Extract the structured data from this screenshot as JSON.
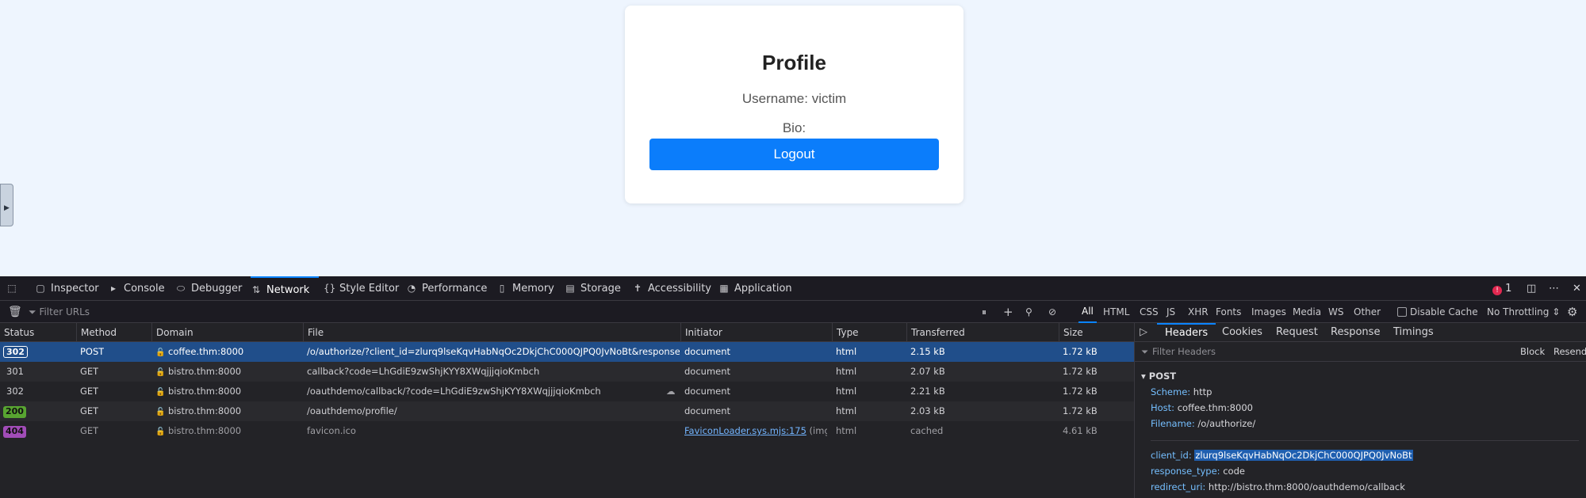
{
  "profile": {
    "title": "Profile",
    "username": "Username: victim",
    "bio": "Bio:",
    "logout": "Logout"
  },
  "devtools": {
    "tabs": [
      "Inspector",
      "Console",
      "Debugger",
      "Network",
      "Style Editor",
      "Performance",
      "Memory",
      "Storage",
      "Accessibility",
      "Application"
    ],
    "active_tab": "Network",
    "error_count": "1",
    "filter_placeholder": "Filter URLs",
    "type_filters": [
      "All",
      "HTML",
      "CSS",
      "JS",
      "XHR",
      "Fonts",
      "Images",
      "Media",
      "WS",
      "Other"
    ],
    "disable_cache": "Disable Cache",
    "throttling": "No Throttling ⇕",
    "columns": [
      "Status",
      "Method",
      "Domain",
      "File",
      "Initiator",
      "Type",
      "Transferred",
      "Size"
    ],
    "rows": [
      {
        "status": "302",
        "method": "POST",
        "domain": "coffee.thm:8000",
        "file": "/o/authorize/?client_id=zlurq9lseKqvHabNqOc2DkjChC000QJPQ0JvNoBt&response_type=",
        "initiator": "document",
        "initiator_suffix": "",
        "type": "html",
        "transferred": "2.15 kB",
        "size": "1.72 kB"
      },
      {
        "status": "301",
        "method": "GET",
        "domain": "bistro.thm:8000",
        "file": "callback?code=LhGdiE9zwShjKYY8XWqjjjqioKmbch",
        "initiator": "document",
        "initiator_suffix": "",
        "type": "html",
        "transferred": "2.07 kB",
        "size": "1.72 kB"
      },
      {
        "status": "302",
        "method": "GET",
        "domain": "bistro.thm:8000",
        "file": "/oauthdemo/callback/?code=LhGdiE9zwShjKYY8XWqjjjqioKmbch",
        "initiator": "document",
        "initiator_suffix": "",
        "type": "html",
        "transferred": "2.21 kB",
        "size": "1.72 kB"
      },
      {
        "status": "200",
        "method": "GET",
        "domain": "bistro.thm:8000",
        "file": "/oauthdemo/profile/",
        "initiator": "document",
        "initiator_suffix": "",
        "type": "html",
        "transferred": "2.03 kB",
        "size": "1.72 kB"
      },
      {
        "status": "404",
        "method": "GET",
        "domain": "bistro.thm:8000",
        "file": "favicon.ico",
        "initiator": "FaviconLoader.sys.mjs:175",
        "initiator_suffix": " (img)",
        "type": "html",
        "transferred": "cached",
        "size": "4.61 kB"
      }
    ],
    "side_tabs": [
      "Headers",
      "Cookies",
      "Request",
      "Response",
      "Timings"
    ],
    "side_filter_placeholder": "Filter Headers",
    "block": "Block",
    "resend": "Resend",
    "method_section": "POST",
    "headers": {
      "scheme_k": "Scheme:",
      "scheme_v": "http",
      "host_k": "Host:",
      "host_v": "coffee.thm:8000",
      "filename_k": "Filename:",
      "filename_v": "/o/authorize/"
    },
    "params": {
      "client_id_k": "client_id:",
      "client_id_v": "zlurq9lseKqvHabNqOc2DkjChC000QJPQ0JvNoBt",
      "response_type_k": "response_type:",
      "response_type_v": "code",
      "redirect_uri_k": "redirect_uri:",
      "redirect_uri_v": "http://bistro.thm:8000/oauthdemo/callback"
    }
  }
}
